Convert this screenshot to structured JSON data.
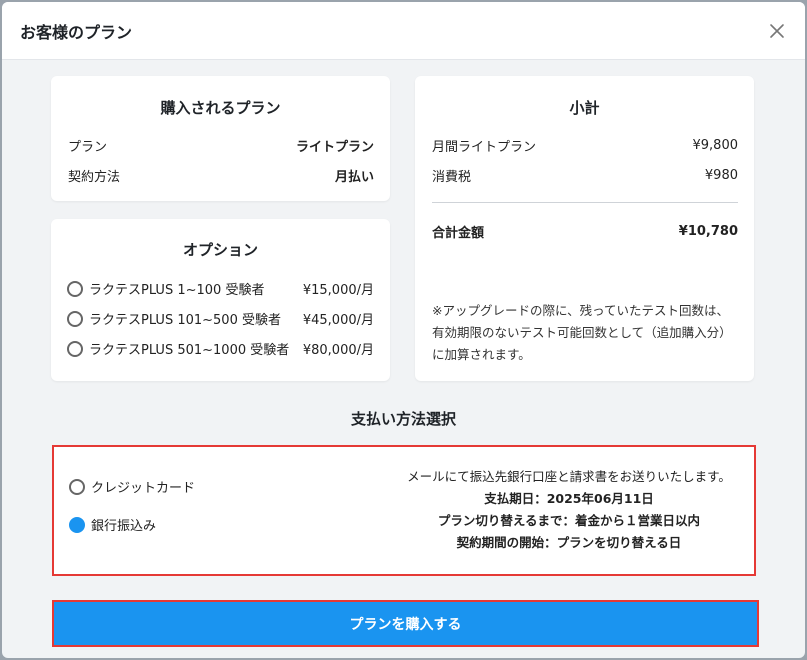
{
  "modal": {
    "title": "お客様のプラン"
  },
  "plan_card": {
    "title": "購入されるプラン",
    "rows": [
      {
        "label": "プラン",
        "value": "ライトプラン"
      },
      {
        "label": "契約方法",
        "value": "月払い"
      }
    ]
  },
  "options_card": {
    "title": "オプション",
    "items": [
      {
        "label": "ラクテスPLUS 1~100 受験者",
        "price": "¥15,000/月",
        "selected": false
      },
      {
        "label": "ラクテスPLUS 101~500 受験者",
        "price": "¥45,000/月",
        "selected": false
      },
      {
        "label": "ラクテスPLUS 501~1000 受験者",
        "price": "¥80,000/月",
        "selected": false
      }
    ]
  },
  "subtotal_card": {
    "title": "小計",
    "rows": [
      {
        "label": "月間ライトプラン",
        "value": "¥9,800"
      },
      {
        "label": "消費税",
        "value": "¥980"
      }
    ],
    "total_label": "合計金額",
    "total_value": "¥10,780",
    "note": "※アップグレードの際に、残っていたテスト回数は、有効期限のないテスト可能回数として（追加購入分）に加算されます。"
  },
  "payment": {
    "section_title": "支払い方法選択",
    "methods": [
      {
        "label": "クレジットカード",
        "selected": false
      },
      {
        "label": "銀行振込み",
        "selected": true
      }
    ],
    "info": {
      "line1": "メールにて振込先銀行口座と請求書をお送りいたします。",
      "line2": "支払期日：2025年06月11日",
      "line3": "プラン切り替えるまで：着金から１営業日以内",
      "line4": "契約期間の開始：プランを切り替える日"
    }
  },
  "buy_button": {
    "label": "プランを購入する"
  },
  "colors": {
    "accent": "#1a94f0",
    "highlight_border": "#e53935"
  }
}
